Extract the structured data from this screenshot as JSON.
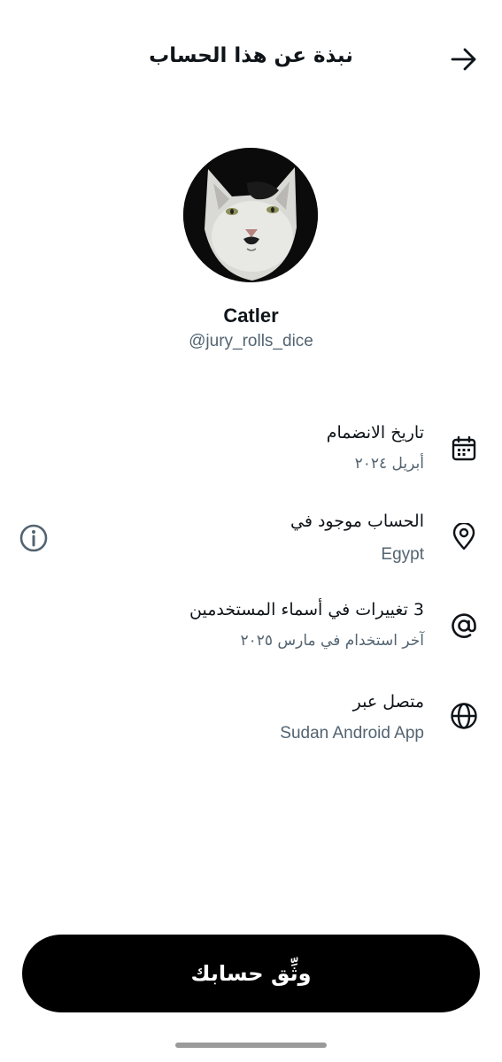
{
  "header": {
    "title": "نبذة عن هذا الحساب",
    "back_icon": "arrow-right-icon"
  },
  "profile": {
    "display_name": "Catler",
    "handle": "@jury_rolls_dice",
    "avatar_icon": "cat-avatar"
  },
  "rows": [
    {
      "icon": "calendar-icon",
      "title": "تاريخ الانضمام",
      "subtitle": "أبريل ٢٠٢٤"
    },
    {
      "icon": "location-pin-icon",
      "title": "الحساب موجود في",
      "subtitle": "Egypt",
      "extra_icon": "info-icon"
    },
    {
      "icon": "at-sign-icon",
      "title": "3 تغييرات في أسماء المستخدمين",
      "subtitle": "آخر استخدام في مارس ٢٠٢٥"
    },
    {
      "icon": "globe-icon",
      "title": "متصل عبر",
      "subtitle": "Sudan Android App"
    }
  ],
  "verify_button": {
    "label": "وثِّق حسابك"
  },
  "colors": {
    "text": "#0f1419",
    "secondary": "#536471",
    "button_bg": "#000000"
  }
}
